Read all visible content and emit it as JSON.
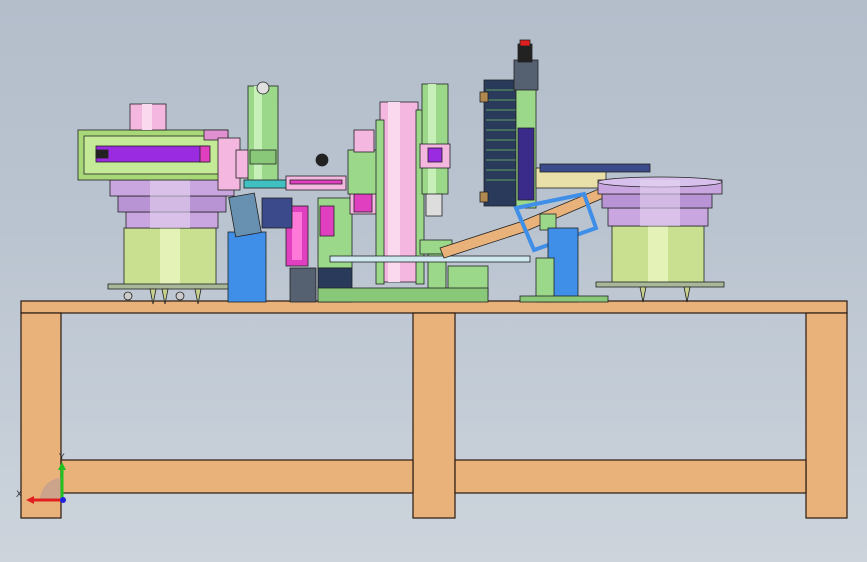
{
  "viewport": {
    "background_top": "#b4becb",
    "background_bottom": "#cdd4dc"
  },
  "model": {
    "table_color": "#e8b27a",
    "bowl_color": "#c9a6e0",
    "bowl_base_color": "#c8e090",
    "pink_color": "#f4b8e0",
    "green_color": "#9bd88a",
    "blue_color": "#3f8fe8",
    "purple_color": "#9a2be0",
    "magenta_color": "#e040c0"
  },
  "triad": {
    "x_label": "X",
    "y_label": "Y",
    "x_color": "#e02020",
    "y_color": "#20c020",
    "z_color": "#2020e0"
  }
}
